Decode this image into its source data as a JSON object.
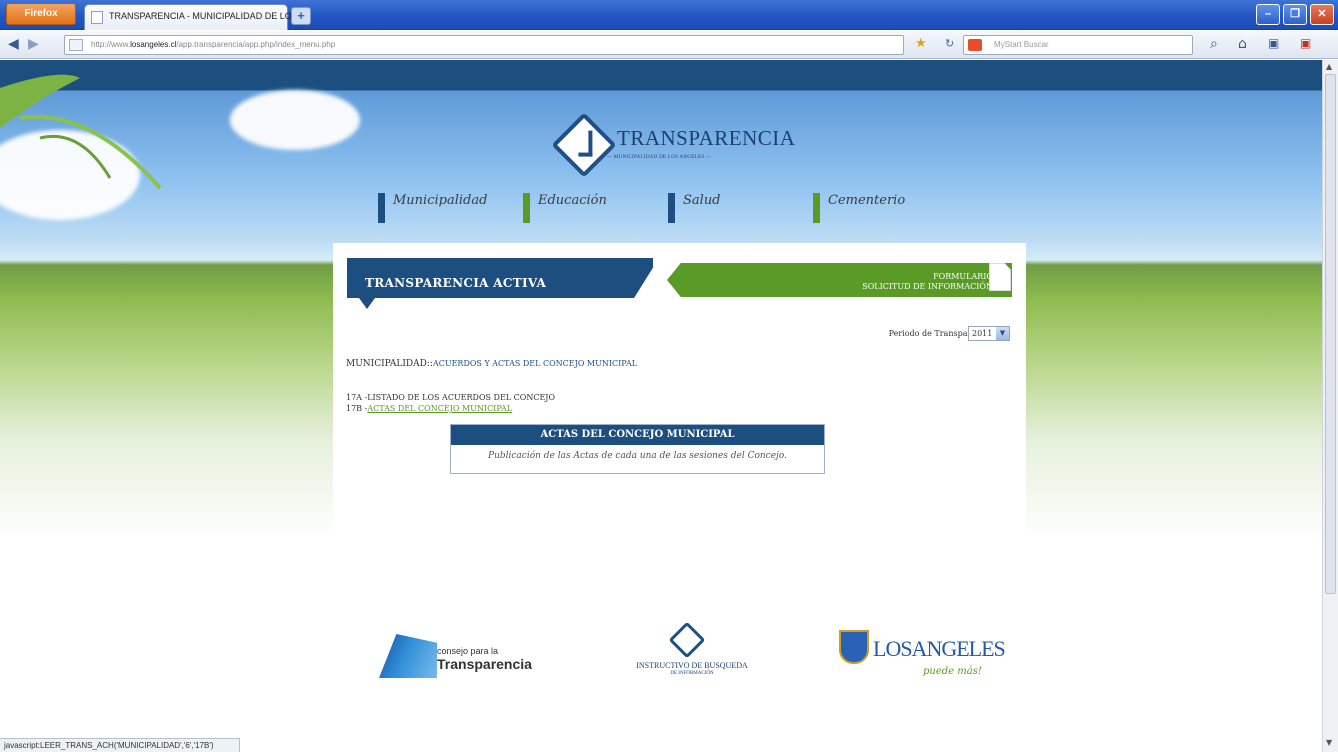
{
  "browser": {
    "menu_button": "Firefox",
    "tab_title": "TRANSPARENCIA - MUNICIPALIDAD DE LOS...",
    "new_tab": "+",
    "url_prefix": "http://www.",
    "url_domain": "losangeles.cl",
    "url_path": "/app.transparencia/app.php/index_menu.php",
    "search_placeholder": "MyStart Buscar",
    "status_text": "javascript:LEER_TRANS_ACH('MUNICIPALIDAD','6','17B')"
  },
  "site": {
    "logo_name": "TRANSPARENCIA",
    "logo_sub": "— MUNICIPALIDAD DE LOS ANGELES —",
    "nav": [
      {
        "label": "Municipalidad",
        "color": "#1c4f80"
      },
      {
        "label": "Educación",
        "color": "#5a9a26"
      },
      {
        "label": "Salud",
        "color": "#1c4f80"
      },
      {
        "label": "Cementerio",
        "color": "#5a9a26"
      }
    ]
  },
  "main": {
    "banner_title": "TRANSPARENCIA ACTIVA",
    "form_line1": "FORMULARIO",
    "form_line2": "SOLICITUD DE INFORMACIÓN",
    "periodo_label": "Periodo de Transparencia",
    "periodo_value": "2011",
    "breadcrumb_prefix": "MUNICIPALIDAD",
    "breadcrumb_sep": "::",
    "breadcrumb_link": "ACUERDOS Y ACTAS DEL CONCEJO MUNICIPAL",
    "item_17a": "17A -LISTADO DE LOS ACUERDOS DEL CONCEJO",
    "item_17b_prefix": "17B -",
    "item_17b_link": "ACTAS DEL CONCEJO MUNICIPAL",
    "tooltip_title": "ACTAS DEL CONCEJO MUNICIPAL",
    "tooltip_body": "Publicación de las Actas de cada una de las sesiones del Concejo."
  },
  "footer": {
    "logo1_line1": "consejo para la",
    "logo1_line2": "Transparencia",
    "logo2_line1": "INSTRUCTIVO DE BUSQUEDA",
    "logo2_line2": "DE INFORMACIÓN",
    "logo3_line1": "LOSANGELES",
    "logo3_line2": "puede más!"
  }
}
